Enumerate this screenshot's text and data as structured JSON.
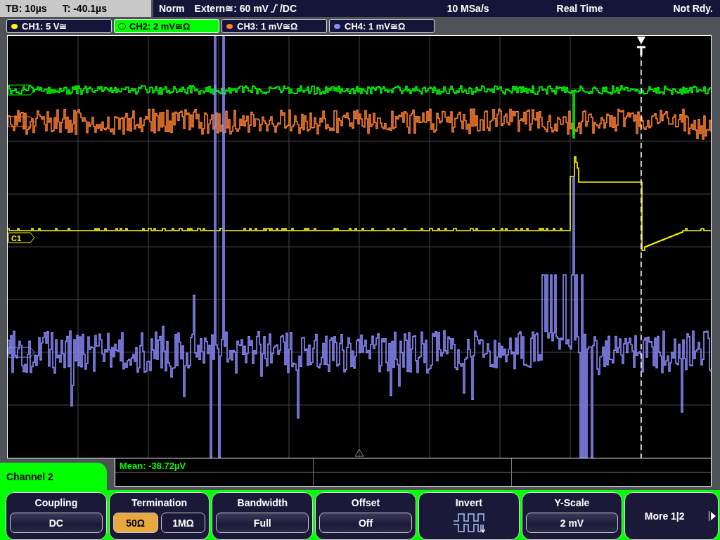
{
  "status_bar": {
    "timebase": "TB: 10µs",
    "trigger_time": "T: -40.1µs",
    "mode": "Norm",
    "trigger_source": "Extern≅: 60 mV",
    "trigger_coupling": "/DC",
    "sample_rate": "10 MSa/s",
    "acquisition": "Real Time",
    "state": "Not Rdy."
  },
  "channels": [
    {
      "label": "CH1: 5 V≅",
      "color": "#ffff00",
      "selected": false,
      "marker_label": "C1"
    },
    {
      "label": "CH2: 2 mV≅Ω",
      "color": "#00ff00",
      "selected": true
    },
    {
      "label": "CH3: 1 mV≅Ω",
      "color": "#ff8030",
      "selected": false
    },
    {
      "label": "CH4: 1 mV≅Ω",
      "color": "#8c8cff",
      "selected": false
    }
  ],
  "measurement": {
    "text": "Mean: -38.72µV"
  },
  "menu": {
    "title": "Channel 2",
    "softkeys": [
      {
        "kind": "select",
        "label": "Coupling",
        "value": "DC"
      },
      {
        "kind": "toggle",
        "label": "Termination",
        "options": [
          {
            "label": "50Ω",
            "selected": true
          },
          {
            "label": "1MΩ",
            "selected": false
          }
        ]
      },
      {
        "kind": "select",
        "label": "Bandwidth",
        "value": "Full"
      },
      {
        "kind": "select",
        "label": "Offset",
        "value": "Off"
      },
      {
        "kind": "icon",
        "label": "Invert"
      },
      {
        "kind": "select",
        "label": "Y-Scale",
        "value": "2 mV"
      },
      {
        "kind": "more",
        "label": "More 1|2"
      }
    ]
  }
}
